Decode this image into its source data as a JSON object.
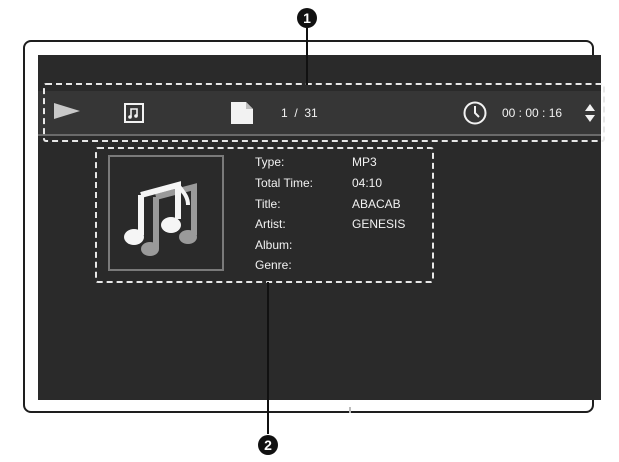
{
  "callouts": {
    "one": "1",
    "two": "2"
  },
  "infobar": {
    "play_icon": "play-triangle-icon",
    "music_icon": "music-note-square-icon",
    "file_icon": "document-icon",
    "track_position": "1  /  31",
    "clock_icon": "clock-icon",
    "elapsed_time": "00 : 00 : 16",
    "updown_icon": "up-down-arrows-icon"
  },
  "track_info": {
    "album_art_icon": "music-notes-icon",
    "fields": [
      {
        "label": "Type:",
        "value": "MP3"
      },
      {
        "label": "Total Time:",
        "value": "04:10"
      },
      {
        "label": "Title:",
        "value": "ABACAB"
      },
      {
        "label": "Artist:",
        "value": "GENESIS"
      },
      {
        "label": "Album:",
        "value": ""
      },
      {
        "label": "Genre:",
        "value": ""
      }
    ]
  },
  "colors": {
    "screen_bg": "#2a2a2a",
    "infobar_bg": "#363636",
    "text": "#f2f2f2",
    "callout": "#111111",
    "dashed_outline": "#e8e8e8"
  }
}
